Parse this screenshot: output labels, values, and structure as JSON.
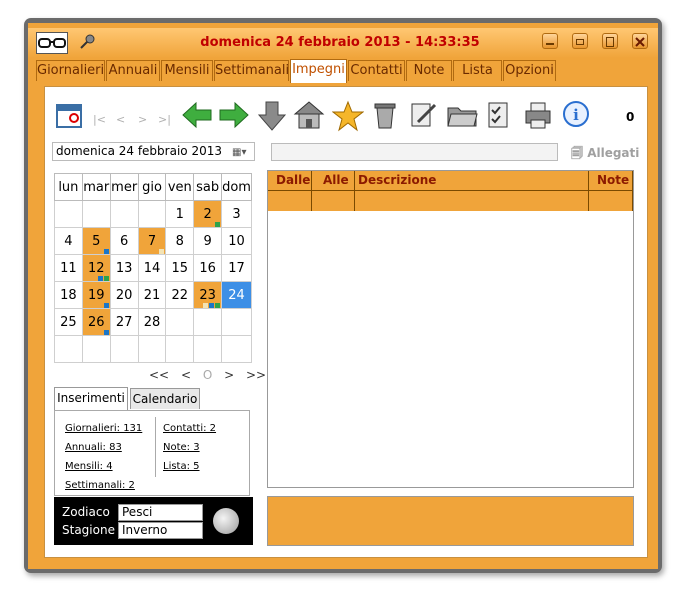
{
  "window": {
    "title": "domenica 24 febbraio 2013 - 14:33:35"
  },
  "tabs": [
    {
      "label": "Giornalieri"
    },
    {
      "label": "Annuali"
    },
    {
      "label": "Mensili"
    },
    {
      "label": "Settimanali"
    },
    {
      "label": "Impegni",
      "active": true
    },
    {
      "label": "Contatti"
    },
    {
      "label": "Note"
    },
    {
      "label": "Lista"
    },
    {
      "label": "Opzioni"
    }
  ],
  "toolbar": {
    "icons": [
      "calendar-icon",
      "first-icon",
      "prev-icon",
      "next-icon",
      "last-icon",
      "back-arrow-icon",
      "forward-arrow-icon",
      "download-icon",
      "home-icon",
      "star-icon",
      "trash-icon",
      "edit-icon",
      "folder-icon",
      "checklist-icon",
      "printer-icon",
      "info-icon"
    ],
    "count": "0"
  },
  "date_field": {
    "value": "domenica 24  febbraio  2013"
  },
  "allegati": {
    "label": "Allegati"
  },
  "calendar": {
    "weekdays": [
      "lun",
      "mar",
      "mer",
      "gio",
      "ven",
      "sab",
      "dom"
    ],
    "weeks": [
      [
        "",
        "",
        "",
        "",
        "1",
        "2",
        "3"
      ],
      [
        "4",
        "5",
        "6",
        "7",
        "8",
        "9",
        "10"
      ],
      [
        "11",
        "12",
        "13",
        "14",
        "15",
        "16",
        "17"
      ],
      [
        "18",
        "19",
        "20",
        "21",
        "22",
        "23",
        "24"
      ],
      [
        "25",
        "26",
        "27",
        "28",
        "",
        "",
        ""
      ],
      [
        "",
        "",
        "",
        "",
        "",
        "",
        ""
      ]
    ],
    "highlighted": [
      "2",
      "5",
      "7",
      "12",
      "19",
      "23",
      "26"
    ],
    "today": "24",
    "colors": {
      "highlight": "#f0a43a",
      "today": "#3d8fe6",
      "mark_blue": "#1b76c8",
      "mark_green": "#2ea34a",
      "mark_cream": "#f3e3b4"
    },
    "nav": {
      "first": "<<",
      "prev": "<",
      "center": "O",
      "next": ">",
      "last": ">>"
    }
  },
  "subtabs": [
    {
      "label": "Inserimenti",
      "active": true
    },
    {
      "label": "Calendario"
    }
  ],
  "stats": {
    "left": [
      "Giornalieri: 131",
      "Annuali: 83",
      "Mensili: 4",
      "Settimanali: 2"
    ],
    "right": [
      "Contatti: 2",
      "Note: 3",
      "Lista: 5"
    ]
  },
  "zodiac": {
    "zodiaco_label": "Zodiaco",
    "zodiaco_value": "Pesci",
    "stagione_label": "Stagione",
    "stagione_value": "Inverno"
  },
  "grid": {
    "columns": [
      "Dalle",
      "Alle",
      "Descrizione",
      "Note"
    ]
  }
}
